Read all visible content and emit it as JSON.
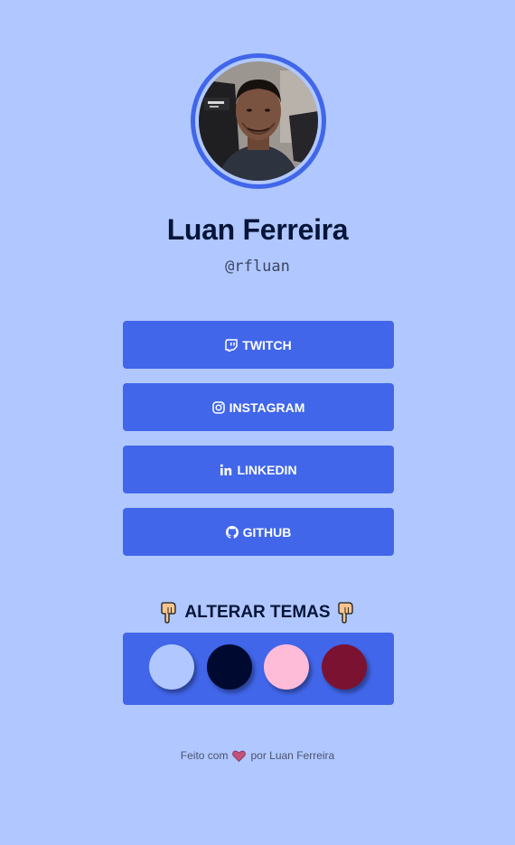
{
  "profile": {
    "name": "Luan Ferreira",
    "handle": "@rfluan"
  },
  "links": [
    {
      "label": "TWITCH",
      "icon": "twitch-icon"
    },
    {
      "label": "INSTAGRAM",
      "icon": "instagram-icon"
    },
    {
      "label": "LINKEDIN",
      "icon": "linkedin-icon"
    },
    {
      "label": "GITHUB",
      "icon": "github-icon"
    }
  ],
  "themes": {
    "title": "ALTERAR TEMAS",
    "swatches": [
      {
        "name": "light-blue",
        "color": "#b0c8ff"
      },
      {
        "name": "navy",
        "color": "#000a30"
      },
      {
        "name": "pink",
        "color": "#ffbcd9"
      },
      {
        "name": "wine",
        "color": "#7b1232"
      }
    ]
  },
  "footer": {
    "before": "Feito com",
    "after": "por Luan Ferreira"
  },
  "colors": {
    "background": "#b0c8ff",
    "accent": "#4166ea",
    "text_dark": "#061538"
  }
}
